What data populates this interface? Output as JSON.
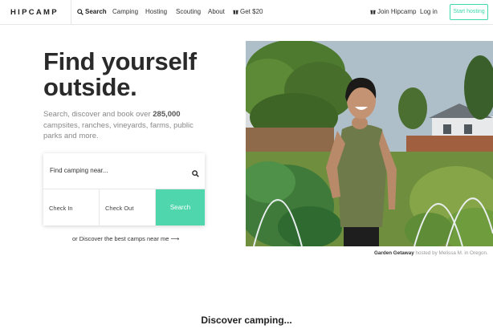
{
  "nav": {
    "logo": "HIPCAMP",
    "links": [
      {
        "label": "Search",
        "icon": "search-icon"
      },
      {
        "label": "Camping"
      },
      {
        "label": "Hosting"
      },
      {
        "label": "Scouting"
      },
      {
        "label": "About"
      },
      {
        "label": "Get $20",
        "icon": "gift-icon"
      }
    ],
    "right": {
      "join": "Join Hipcamp",
      "join_icon": "gift-icon",
      "login": "Log in",
      "start_hosting": "Start hosting"
    }
  },
  "hero": {
    "title": "Find yourself outside.",
    "subtitle_before": "Search, discover and book over ",
    "subtitle_highlight": "285,000",
    "subtitle_after": " campsites, ranches, vineyards, farms, public parks and more."
  },
  "search": {
    "where_placeholder": "Find camping near...",
    "check_in": "Check In",
    "check_out": "Check Out",
    "button": "Search",
    "discover_link": "or Discover the best camps near me ⟶"
  },
  "photo": {
    "caption_title": "Garden Getaway",
    "caption_rest": " hosted by Melissa M. in Oregon."
  },
  "section": {
    "heading": "Discover camping..."
  },
  "colors": {
    "accent": "#40d9ac",
    "search_button": "#4fd6ac",
    "text_dark": "#2a2a2a",
    "text_muted": "#888888"
  }
}
